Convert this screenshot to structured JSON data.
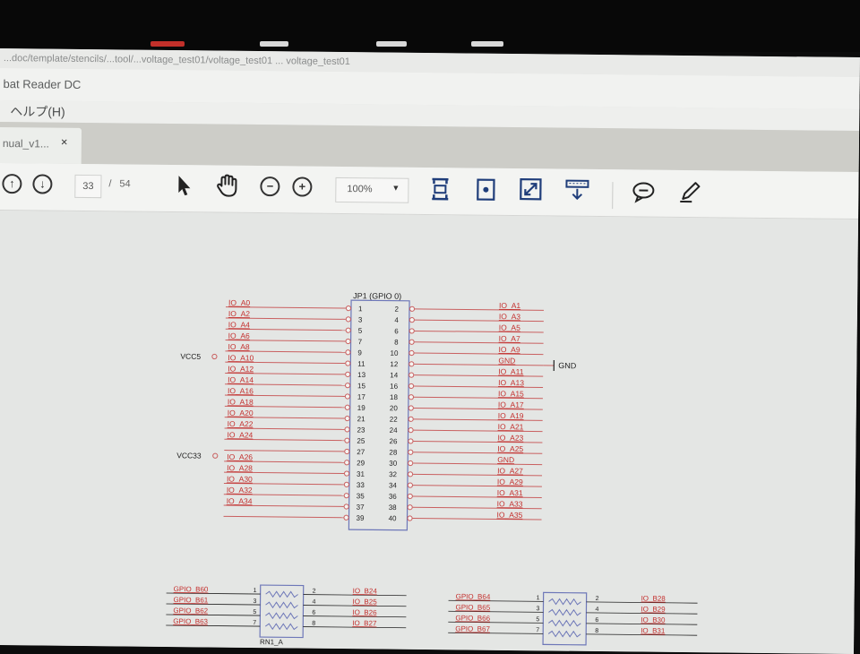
{
  "window": {
    "path": "...doc/template/stencils/...tool/...voltage_test01/voltage_test01 ... voltage_test01",
    "title": "bat Reader DC"
  },
  "menu": {
    "help": "ヘルプ(H)"
  },
  "tab": {
    "label": "nual_v1...",
    "close": "×"
  },
  "toolbar": {
    "page_current": "33",
    "page_sep": "/",
    "page_total": "54",
    "zoom": "100%",
    "zoom_arrow": "▼",
    "icons": [
      "page-up-icon",
      "page-down-icon",
      "select-arrow-icon",
      "hand-icon",
      "zoom-out-icon",
      "zoom-in-icon",
      "fit-page-icon",
      "rotate-icon",
      "fullscreen-icon",
      "scroll-mode-icon",
      "comment-icon",
      "highlight-pen-icon"
    ]
  },
  "schematic": {
    "title": "JP1 (GPIO 0)",
    "vcc5": "VCC5",
    "vcc33": "VCC33",
    "gnd_symbol": "GND",
    "odd_pins": [
      {
        "num": "1",
        "net": "IO_A0"
      },
      {
        "num": "3",
        "net": "IO_A2"
      },
      {
        "num": "5",
        "net": "IO_A4"
      },
      {
        "num": "7",
        "net": "IO_A6"
      },
      {
        "num": "9",
        "net": "IO_A8"
      },
      {
        "num": "11",
        "net": "IO_A10"
      },
      {
        "num": "13",
        "net": "IO_A12"
      },
      {
        "num": "15",
        "net": "IO_A14"
      },
      {
        "num": "17",
        "net": "IO_A16"
      },
      {
        "num": "19",
        "net": "IO_A18"
      },
      {
        "num": "21",
        "net": "IO_A20"
      },
      {
        "num": "23",
        "net": "IO_A22"
      },
      {
        "num": "25",
        "net": "IO_A24"
      },
      {
        "num": "27",
        "net": ""
      },
      {
        "num": "29",
        "net": "IO_A26"
      },
      {
        "num": "31",
        "net": "IO_A28"
      },
      {
        "num": "33",
        "net": "IO_A30"
      },
      {
        "num": "35",
        "net": "IO_A32"
      },
      {
        "num": "37",
        "net": "IO_A34"
      },
      {
        "num": "39",
        "net": ""
      }
    ],
    "even_pins": [
      {
        "num": "2",
        "net": "IO_A1"
      },
      {
        "num": "4",
        "net": "IO_A3"
      },
      {
        "num": "6",
        "net": "IO_A5"
      },
      {
        "num": "8",
        "net": "IO_A7"
      },
      {
        "num": "10",
        "net": "IO_A9"
      },
      {
        "num": "12",
        "net": "GND"
      },
      {
        "num": "14",
        "net": "IO_A11"
      },
      {
        "num": "16",
        "net": "IO_A13"
      },
      {
        "num": "18",
        "net": "IO_A15"
      },
      {
        "num": "20",
        "net": "IO_A17"
      },
      {
        "num": "22",
        "net": "IO_A19"
      },
      {
        "num": "24",
        "net": "IO_A21"
      },
      {
        "num": "26",
        "net": "IO_A23"
      },
      {
        "num": "28",
        "net": "IO_A25"
      },
      {
        "num": "30",
        "net": "GND"
      },
      {
        "num": "32",
        "net": "IO_A27"
      },
      {
        "num": "34",
        "net": "IO_A29"
      },
      {
        "num": "36",
        "net": "IO_A31"
      },
      {
        "num": "38",
        "net": "IO_A33"
      },
      {
        "num": "40",
        "net": "IO_A35"
      }
    ],
    "rn_left": {
      "inputs": [
        "GPIO_B60",
        "GPIO_B61",
        "GPIO_B62",
        "GPIO_B63"
      ],
      "in_pins": [
        "1",
        "3",
        "5",
        "7"
      ],
      "out_pins": [
        "2",
        "4",
        "6",
        "8"
      ],
      "outputs": [
        "IO_B24",
        "IO_B25",
        "IO_B26",
        "IO_B27"
      ],
      "label": "RN1_A"
    },
    "rn_right": {
      "inputs": [
        "GPIO_B64",
        "GPIO_B65",
        "GPIO_B66",
        "GPIO_B67"
      ],
      "in_pins": [
        "1",
        "3",
        "5",
        "7"
      ],
      "out_pins": [
        "2",
        "4",
        "6",
        "8"
      ],
      "outputs": [
        "IO_B28",
        "IO_B29",
        "IO_B30",
        "IO_B31"
      ]
    }
  },
  "colors": {
    "net_red": "#c4302e",
    "wire_red": "#c96060",
    "body_blue": "#6d77b8",
    "black": "#222222"
  }
}
